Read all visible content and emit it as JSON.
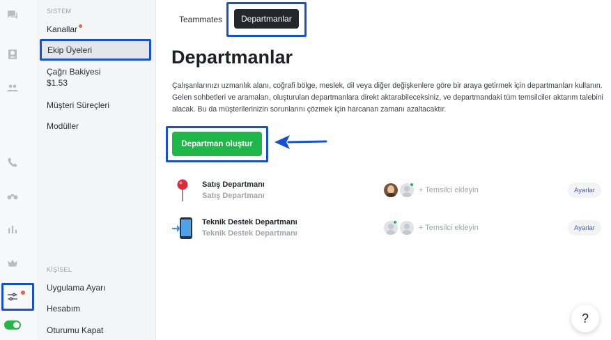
{
  "sidebar": {
    "system_label": "SISTEM",
    "personal_label": "KİŞİSEL",
    "items": [
      {
        "label": "Kanallar"
      },
      {
        "label": "Ekip Üyeleri"
      },
      {
        "label": "Çağrı Bakiyesi"
      },
      {
        "label": "Müşteri Süreçleri"
      },
      {
        "label": "Modüller"
      }
    ],
    "balance": "$1.53",
    "personal_items": [
      {
        "label": "Uygulama Ayarı"
      },
      {
        "label": "Hesabım"
      },
      {
        "label": "Oturumu Kapat"
      }
    ]
  },
  "rail": {
    "icons": [
      "chat-icon",
      "inbox-icon",
      "contacts-icon",
      "phone-icon",
      "binoculars-icon",
      "bar-chart-icon",
      "crown-icon",
      "sliders-icon"
    ],
    "toggle_on": true
  },
  "tabs": {
    "teammates": "Teammates",
    "departments": "Departmanlar"
  },
  "main": {
    "title": "Departmanlar",
    "description": "Çalışanlarınızı uzmanlık alanı, coğrafi bölge, meslek, dil veya diğer değişkenlere göre bir araya getirmek için departmanları kullanın. Gelen sohbetleri ve aramaları, oluşturulan departmanlara direkt aktarabileceksiniz, ve departmandaki tüm temsilciler aktarım talebini alacak. Bu da müşterilerinizin sorunlarını çözmek için harcanan zamanı azaltacaktır.",
    "create_button": "Departman oluştur"
  },
  "departments": [
    {
      "name": "Satış Departmanı",
      "subtitle": "Satış Departmanı",
      "add_agent": "+ Temsilci ekleyin",
      "settings": "Ayarlar",
      "icon": "pushpin-icon"
    },
    {
      "name": "Teknik Destek Departmanı",
      "subtitle": "Teknik Destek Departmanı",
      "add_agent": "+ Temsilci ekleyin",
      "settings": "Ayarlar",
      "icon": "mobile-incoming-icon"
    }
  ],
  "help": "?",
  "colors": {
    "accent_green": "#1fb848",
    "highlight_blue": "#1450d8",
    "notification_red": "#f0604a"
  }
}
